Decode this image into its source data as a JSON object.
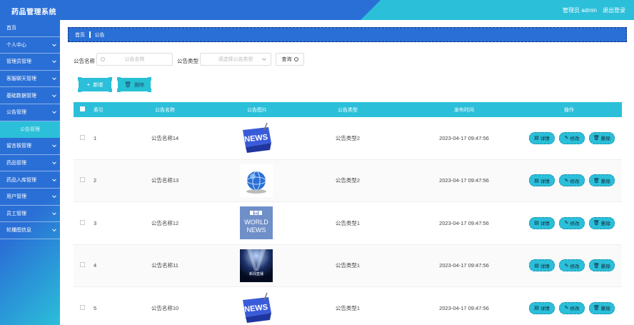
{
  "header": {
    "title": "药品管理系统",
    "user": "管理员 admin",
    "logout": "退出登录"
  },
  "sidebar": {
    "items": [
      {
        "label": "首页",
        "chev": false
      },
      {
        "label": "个人中心",
        "chev": true
      },
      {
        "label": "管理员管理",
        "chev": true
      },
      {
        "label": "客服聊天管理",
        "chev": true
      },
      {
        "label": "基础数据管理",
        "chev": true
      },
      {
        "label": "公告管理",
        "chev": true,
        "expanded": true
      },
      {
        "label": "留言板管理",
        "chev": true
      },
      {
        "label": "药品管理",
        "chev": true
      },
      {
        "label": "药品入库管理",
        "chev": true
      },
      {
        "label": "用户管理",
        "chev": true
      },
      {
        "label": "员工管理",
        "chev": true
      },
      {
        "label": "轮播图信息",
        "chev": true
      }
    ],
    "sub_item": "公告管理"
  },
  "breadcrumb": {
    "home": "首页",
    "current": "公告"
  },
  "search": {
    "name_label": "公告名称",
    "name_placeholder": "公告名称",
    "type_label": "公告类型",
    "type_placeholder": "请选择公告类型",
    "button": "查询"
  },
  "actions": {
    "add": "新增",
    "delete": "删除"
  },
  "table": {
    "columns": [
      "索引",
      "公告名称",
      "公告图片",
      "公告类型",
      "发布时间",
      "操作"
    ],
    "rows": [
      {
        "index": "1",
        "name": "公告名称14",
        "image": "news-key",
        "type": "公告类型2",
        "time": "2023-04-17 09:47:56"
      },
      {
        "index": "2",
        "name": "公告名称13",
        "image": "globe",
        "type": "公告类型2",
        "time": "2023-04-17 09:47:56"
      },
      {
        "index": "3",
        "name": "公告名称12",
        "image": "bbc-world-news",
        "type": "公告类型1",
        "time": "2023-04-17 09:47:56"
      },
      {
        "index": "4",
        "name": "公告名称11",
        "image": "news-stage",
        "type": "公告类型1",
        "time": "2023-04-17 09:47:56"
      },
      {
        "index": "5",
        "name": "公告名称10",
        "image": "news-key",
        "type": "公告类型1",
        "time": "2023-04-17 09:47:56"
      }
    ],
    "ops": {
      "detail": "详情",
      "edit": "修改",
      "delete": "删除"
    },
    "bbc_text": {
      "line1": "BBC",
      "line2": "WORLD",
      "line3": "NEWS"
    },
    "news_text": "NEWS",
    "stage_text": "新闻直播"
  },
  "colors": {
    "primary": "#2a6fd6",
    "accent": "#2bbfd9"
  }
}
